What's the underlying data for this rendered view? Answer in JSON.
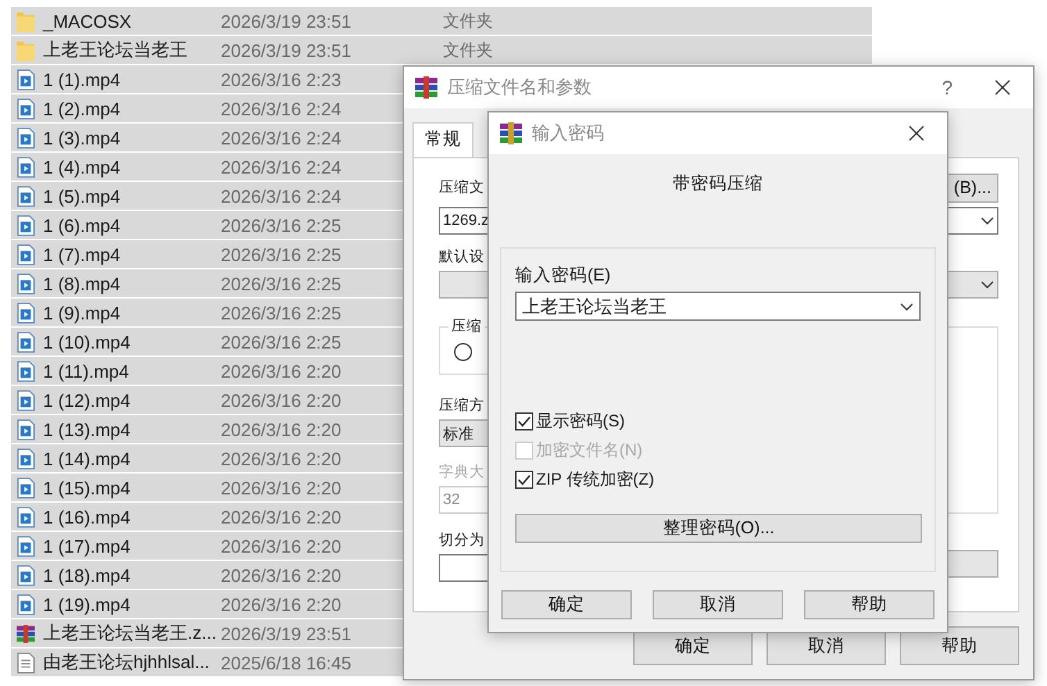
{
  "file_list": [
    {
      "name": "_MACOSX",
      "date": "2026/3/19 23:51",
      "type": "文件夹",
      "kind": "folder",
      "selected": true
    },
    {
      "name": "上老王论坛当老王",
      "date": "2026/3/19 23:51",
      "type": "文件夹",
      "kind": "folder",
      "selected": true
    },
    {
      "name": "1 (1).mp4",
      "date": "2026/3/16 2:23",
      "kind": "video",
      "selected": true
    },
    {
      "name": "1 (2).mp4",
      "date": "2026/3/16 2:24",
      "kind": "video",
      "selected": true
    },
    {
      "name": "1 (3).mp4",
      "date": "2026/3/16 2:24",
      "kind": "video",
      "selected": true
    },
    {
      "name": "1 (4).mp4",
      "date": "2026/3/16 2:24",
      "kind": "video",
      "selected": true
    },
    {
      "name": "1 (5).mp4",
      "date": "2026/3/16 2:24",
      "kind": "video",
      "selected": true
    },
    {
      "name": "1 (6).mp4",
      "date": "2026/3/16 2:25",
      "kind": "video",
      "selected": true
    },
    {
      "name": "1 (7).mp4",
      "date": "2026/3/16 2:25",
      "kind": "video",
      "selected": true
    },
    {
      "name": "1 (8).mp4",
      "date": "2026/3/16 2:25",
      "kind": "video",
      "selected": true
    },
    {
      "name": "1 (9).mp4",
      "date": "2026/3/16 2:25",
      "kind": "video",
      "selected": true
    },
    {
      "name": "1 (10).mp4",
      "date": "2026/3/16 2:25",
      "kind": "video",
      "selected": true
    },
    {
      "name": "1 (11).mp4",
      "date": "2026/3/16 2:20",
      "kind": "video",
      "selected": true
    },
    {
      "name": "1 (12).mp4",
      "date": "2026/3/16 2:20",
      "kind": "video",
      "selected": true
    },
    {
      "name": "1 (13).mp4",
      "date": "2026/3/16 2:20",
      "kind": "video",
      "selected": true
    },
    {
      "name": "1 (14).mp4",
      "date": "2026/3/16 2:20",
      "kind": "video",
      "selected": true
    },
    {
      "name": "1 (15).mp4",
      "date": "2026/3/16 2:20",
      "kind": "video",
      "selected": true
    },
    {
      "name": "1 (16).mp4",
      "date": "2026/3/16 2:20",
      "kind": "video",
      "selected": true
    },
    {
      "name": "1 (17).mp4",
      "date": "2026/3/16 2:20",
      "kind": "video",
      "selected": true
    },
    {
      "name": "1 (18).mp4",
      "date": "2026/3/16 2:20",
      "kind": "video",
      "selected": true
    },
    {
      "name": "1 (19).mp4",
      "date": "2026/3/16 2:20",
      "kind": "video",
      "selected": true
    },
    {
      "name": "上老王论坛当老王.z...",
      "date": "2026/3/19 23:51",
      "kind": "archive",
      "selected": true
    },
    {
      "name": "由老王论坛hjhhlsal...",
      "date": "2025/6/18 16:45",
      "kind": "text",
      "selected": true
    }
  ],
  "compress_dialog": {
    "title": "压缩文件名和参数",
    "help": "?",
    "tabs": [
      {
        "label": "常规",
        "selected": true
      }
    ],
    "archive_name_label": "压缩文",
    "browse_button": "(B)...",
    "archive_name": "1269.z",
    "profile_label": "默认设",
    "format_group": "压缩",
    "format_option": {
      "selected": false
    },
    "method_label": "压缩方",
    "method": "标准",
    "dictionary_label": "字典大",
    "dictionary": "32",
    "dictionary_disabled": true,
    "split_label": "切分为",
    "buttons": [
      "确定",
      "取消",
      "帮助"
    ]
  },
  "password_dialog": {
    "title": "输入密码",
    "heading": "带密码压缩",
    "password_label": "输入密码(E)",
    "password": "上老王论坛当老王",
    "options": [
      {
        "label": "显示密码(S)",
        "checked": true,
        "disabled": false
      },
      {
        "label": "加密文件名(N)",
        "checked": false,
        "disabled": true
      },
      {
        "label": "ZIP 传统加密(Z)",
        "checked": true,
        "disabled": false
      }
    ],
    "organize_button": "整理密码(O)...",
    "buttons": [
      "确定",
      "取消",
      "帮助"
    ]
  }
}
